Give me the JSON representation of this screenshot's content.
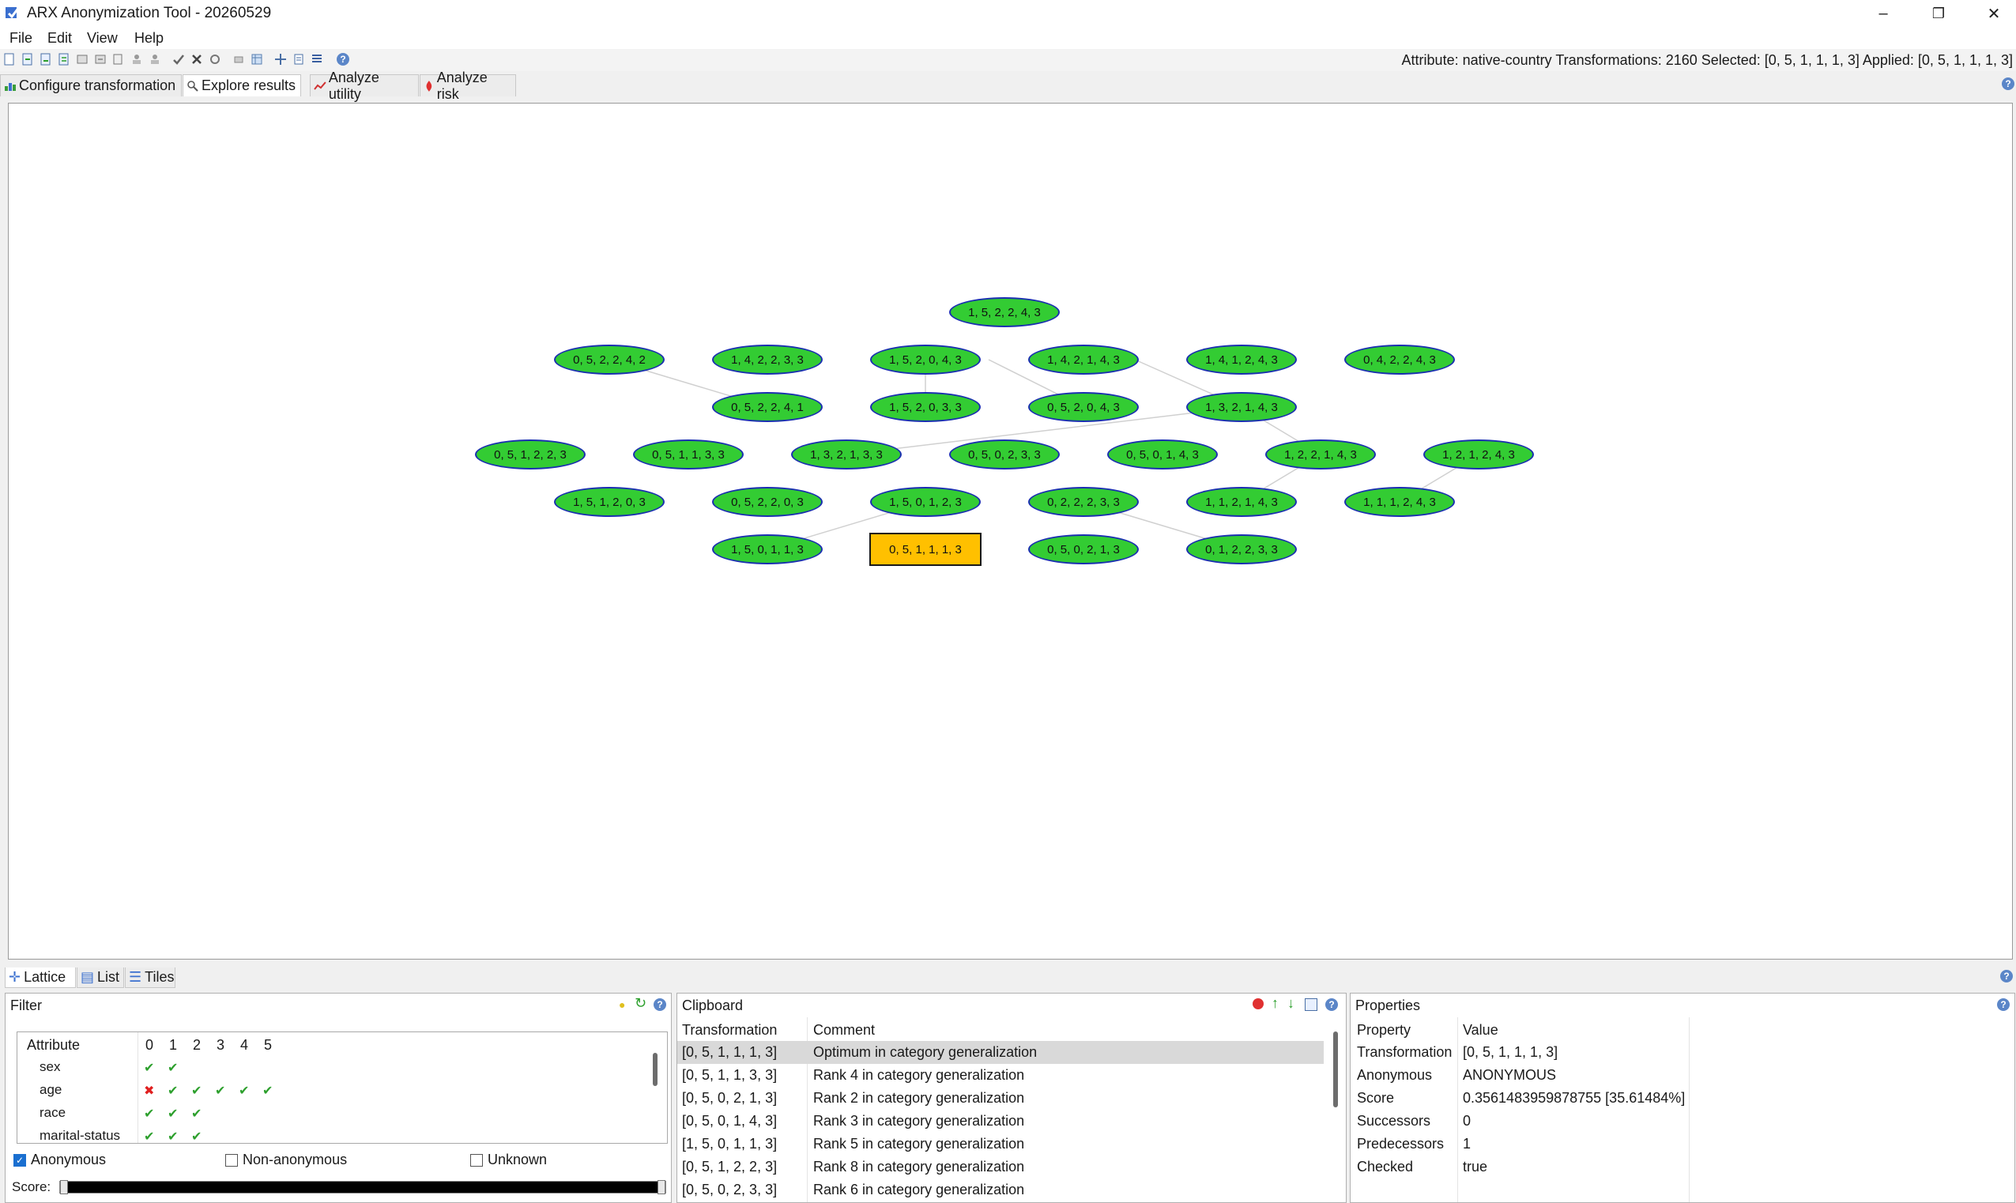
{
  "window": {
    "title": "ARX Anonymization Tool - 20260529",
    "minimize_icon": "minimize-icon",
    "restore_icon": "restore-icon",
    "close_icon": "close-icon"
  },
  "menu": [
    "File",
    "Edit",
    "View",
    "Help"
  ],
  "toolbar": {
    "status": "Attribute: native-country  Transformations: 2160  Selected: [0, 5, 1, 1, 1, 3]  Applied: [0, 5, 1, 1, 1, 3]"
  },
  "tabs": [
    "Configure transformation",
    "Explore results",
    "Analyze utility",
    "Analyze risk"
  ],
  "active_tab": "Explore results",
  "lattice": {
    "nodes": [
      {
        "label": "1, 5, 2, 2, 4, 3"
      },
      {
        "label": "0, 5, 2, 2, 4, 2"
      },
      {
        "label": "1, 4, 2, 2, 3, 3"
      },
      {
        "label": "1, 5, 2, 0, 4, 3"
      },
      {
        "label": "1, 4, 2, 1, 4, 3"
      },
      {
        "label": "1, 4, 1, 2, 4, 3"
      },
      {
        "label": "0, 4, 2, 2, 4, 3"
      },
      {
        "label": "0, 5, 2, 2, 4, 1"
      },
      {
        "label": "1, 5, 2, 0, 3, 3"
      },
      {
        "label": "0, 5, 2, 0, 4, 3"
      },
      {
        "label": "1, 3, 2, 1, 4, 3"
      },
      {
        "label": "0, 5, 1, 2, 2, 3"
      },
      {
        "label": "0, 5, 1, 1, 3, 3"
      },
      {
        "label": "1, 3, 2, 1, 3, 3"
      },
      {
        "label": "0, 5, 0, 2, 3, 3"
      },
      {
        "label": "0, 5, 0, 1, 4, 3"
      },
      {
        "label": "1, 2, 2, 1, 4, 3"
      },
      {
        "label": "1, 2, 1, 2, 4, 3"
      },
      {
        "label": "1, 5, 1, 2, 0, 3"
      },
      {
        "label": "0, 5, 2, 2, 0, 3"
      },
      {
        "label": "1, 5, 0, 1, 2, 3"
      },
      {
        "label": "0, 2, 2, 2, 3, 3"
      },
      {
        "label": "1, 1, 2, 1, 4, 3"
      },
      {
        "label": "1, 1, 1, 2, 4, 3"
      },
      {
        "label": "1, 5, 0, 1, 1, 3"
      },
      {
        "label": "0, 5, 1, 1, 1, 3",
        "selected": true
      },
      {
        "label": "0, 5, 0, 2, 1, 3"
      },
      {
        "label": "0, 1, 2, 2, 3, 3"
      }
    ]
  },
  "lower_tabs": [
    "Lattice",
    "List",
    "Tiles"
  ],
  "filter": {
    "title": "Filter",
    "header": [
      "Attribute",
      "0",
      "1",
      "2",
      "3",
      "4",
      "5"
    ],
    "rows": [
      {
        "name": "sex",
        "levels": [
          "check",
          "check",
          "",
          "",
          "",
          ""
        ]
      },
      {
        "name": "age",
        "levels": [
          "cross",
          "check",
          "check",
          "check",
          "check",
          "check"
        ]
      },
      {
        "name": "race",
        "levels": [
          "check",
          "check",
          "check",
          "",
          "",
          ""
        ]
      },
      {
        "name": "marital-status",
        "levels": [
          "check",
          "check",
          "check",
          "",
          "",
          ""
        ]
      }
    ],
    "anonymous_label": "Anonymous",
    "anonymous_checked": true,
    "nonanonymous_label": "Non-anonymous",
    "nonanonymous_checked": false,
    "unknown_label": "Unknown",
    "unknown_checked": false,
    "score_label": "Score:"
  },
  "clipboard": {
    "title": "Clipboard",
    "col_transformation": "Transformation",
    "col_comment": "Comment",
    "rows": [
      {
        "transformation": "[0, 5, 1, 1, 1, 3]",
        "comment": "Optimum in category generalization"
      },
      {
        "transformation": "[0, 5, 1, 1, 3, 3]",
        "comment": "Rank 4 in category generalization"
      },
      {
        "transformation": "[0, 5, 0, 2, 1, 3]",
        "comment": "Rank 2 in category generalization"
      },
      {
        "transformation": "[0, 5, 0, 1, 4, 3]",
        "comment": "Rank 3 in category generalization"
      },
      {
        "transformation": "[1, 5, 0, 1, 1, 3]",
        "comment": "Rank 5 in category generalization"
      },
      {
        "transformation": "[0, 5, 1, 2, 2, 3]",
        "comment": "Rank 8 in category generalization"
      },
      {
        "transformation": "[0, 5, 0, 2, 3, 3]",
        "comment": "Rank 6 in category generalization"
      }
    ]
  },
  "properties": {
    "title": "Properties",
    "col_property": "Property",
    "col_value": "Value",
    "rows": [
      {
        "property": "Transformation",
        "value": "[0, 5, 1, 1, 1, 3]"
      },
      {
        "property": "Anonymous",
        "value": "ANONYMOUS"
      },
      {
        "property": "Score",
        "value": "0.3561483959878755 [35.61484%]"
      },
      {
        "property": "Successors",
        "value": "0"
      },
      {
        "property": "Predecessors",
        "value": "1"
      },
      {
        "property": "Checked",
        "value": "true"
      }
    ]
  }
}
